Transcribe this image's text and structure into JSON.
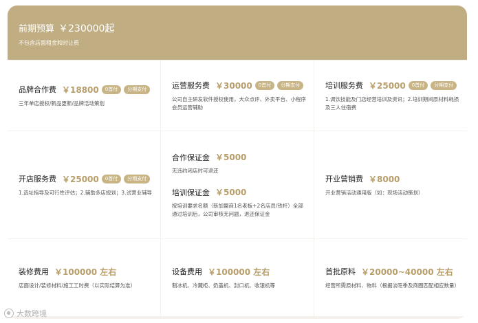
{
  "header": {
    "title": "前期预算",
    "price": "￥230000起",
    "subtitle": "不包含店面租金和时让费"
  },
  "colors": {
    "header_bg": "#c0ad82",
    "price": "#b79e6a",
    "badge_bg": "#c8b485"
  },
  "items": {
    "brand": {
      "name": "品牌合作费",
      "price": "￥18800",
      "badge1": "0首付",
      "badge2": "分期支付",
      "desc": "三年单店授权/新品更新/品牌活动策划"
    },
    "ops": {
      "name": "运营服务费",
      "price": "￥30000",
      "badge1": "0首付",
      "badge2": "分期支付",
      "desc": "公司自主研发软件授权使用，大众点评、外卖平台、小程序会员运营辅助"
    },
    "training": {
      "name": "培训服务费",
      "price": "￥25000",
      "badge1": "0首付",
      "badge2": "分期支付",
      "desc": "1.调饮技能及门店经营培训及资讯；2.培训期间原材料耗损及三人住宿费"
    },
    "opening": {
      "name": "开店服务费",
      "price": "￥25000",
      "badge1": "0首付",
      "badge2": "分期支付",
      "desc": "1.选址指导及可行性评估；2.辅助多店规划；3.试营业辅导"
    },
    "deposit": {
      "name": "合作保证金",
      "price": "￥5000",
      "desc": "无违约闭店时可退还"
    },
    "train_deposit": {
      "name": "培训保证金",
      "price": "￥5000",
      "desc": "按培训要求名额（新加盟商1名老板+2名店员/铁杆）全部通过培训后，公司审核无问题，退还保证金"
    },
    "marketing": {
      "name": "开业营销费",
      "price": "￥8000",
      "desc": "开业营销活动通用版（如：现场活动策划）"
    },
    "decoration": {
      "name": "装修费用",
      "price": "￥100000 左右",
      "desc": "店面设计/装修材料/施工工时费（以实际结算为准）"
    },
    "equipment": {
      "name": "设备费用",
      "price": "￥100000 左右",
      "desc": "制冰机、冷藏柜、奶盖机、封口机、收银机等"
    },
    "materials": {
      "name": "首批原料",
      "price": "￥20000~40000 左右",
      "desc": "经营所需原材料、物料（根据淡旺季及商圈匹配相应数量）"
    }
  },
  "watermark": "大数跨境"
}
